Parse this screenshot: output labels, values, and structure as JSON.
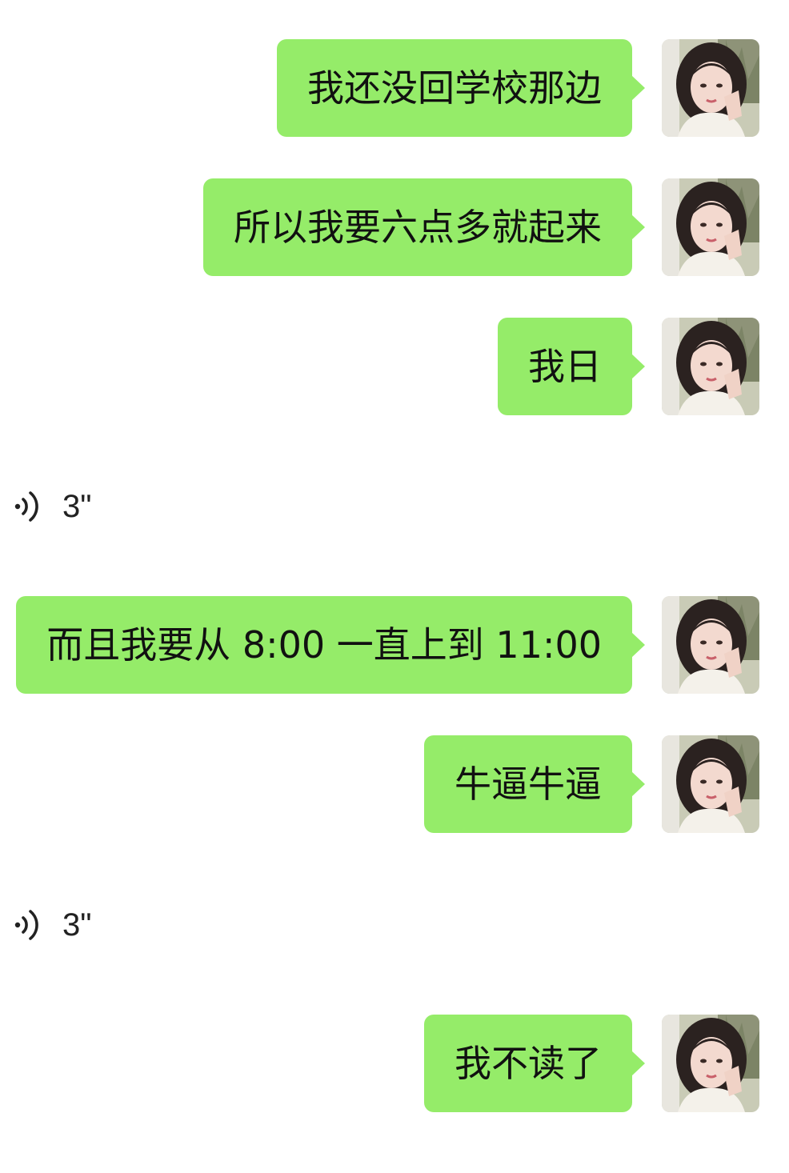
{
  "chat": {
    "messages": [
      {
        "type": "text",
        "text": "我还没回学校那边"
      },
      {
        "type": "text",
        "text": "所以我要六点多就起来"
      },
      {
        "type": "text",
        "text": "我日"
      },
      {
        "type": "voice",
        "duration": "3\""
      },
      {
        "type": "text",
        "text": "而且我要从 8:00 一直上到 11:00"
      },
      {
        "type": "text",
        "text": "牛逼牛逼"
      },
      {
        "type": "voice",
        "duration": "3\""
      },
      {
        "type": "text",
        "text": "我不读了"
      }
    ]
  },
  "colors": {
    "bubble_outgoing": "#95ec69",
    "background": "#ffffff",
    "text": "#111111"
  },
  "icons": {
    "voice": "voice-wave-icon",
    "avatar": "user-avatar-photo"
  }
}
